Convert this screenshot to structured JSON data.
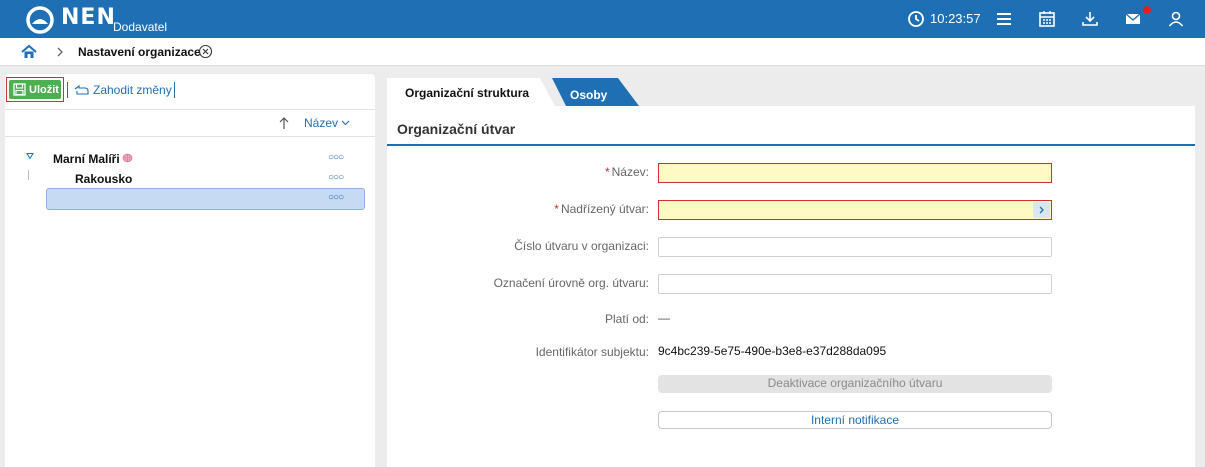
{
  "app": {
    "brand": "NEN",
    "brand_sub": "Dodavatel",
    "clock": "10:23:57"
  },
  "breadcrumb": {
    "current": "Nastavení organizace"
  },
  "toolbar": {
    "save_label": "Uložit",
    "discard_label": "Zahodit změny"
  },
  "tree": {
    "sort_label": "Název",
    "items": [
      {
        "label": "Marní Malíři",
        "level": 0,
        "expanded": true
      },
      {
        "label": "Rakousko",
        "level": 1
      },
      {
        "label": "",
        "level": 1,
        "selected": true
      }
    ]
  },
  "tabs": [
    {
      "label": "Organizační struktura",
      "active": true
    },
    {
      "label": "Osoby",
      "active": false
    }
  ],
  "form": {
    "section_title": "Organizační útvar",
    "fields": {
      "nazev": {
        "label": "Název:",
        "value": "",
        "required": true
      },
      "nadrizeny": {
        "label": "Nadřízený útvar:",
        "value": "",
        "required": true
      },
      "cislo": {
        "label": "Číslo útvaru v organizaci:",
        "value": ""
      },
      "oznaceni": {
        "label": "Označení úrovně org. útvaru:",
        "value": ""
      },
      "plati_od": {
        "label": "Platí od:",
        "value": "—"
      },
      "identifikator": {
        "label": "Identifikátor subjektu:",
        "value": "9c4bc239-5e75-490e-b3e8-e37d288da095"
      }
    },
    "deactivate_label": "Deaktivace organizačního útvaru",
    "notifications_label": "Interní notifikace"
  },
  "colors": {
    "primary": "#1f6fb4",
    "save": "#4caf50",
    "required_bg": "#fff9c4",
    "required_border": "#d32f2f"
  }
}
